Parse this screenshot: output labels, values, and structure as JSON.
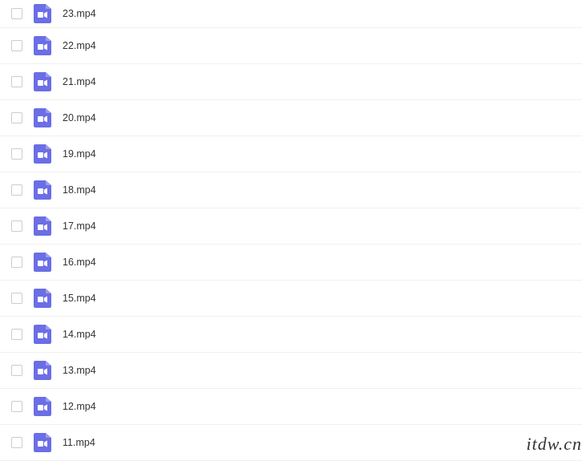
{
  "files": [
    {
      "name": "23.mp4"
    },
    {
      "name": "22.mp4"
    },
    {
      "name": "21.mp4"
    },
    {
      "name": "20.mp4"
    },
    {
      "name": "19.mp4"
    },
    {
      "name": "18.mp4"
    },
    {
      "name": "17.mp4"
    },
    {
      "name": "16.mp4"
    },
    {
      "name": "15.mp4"
    },
    {
      "name": "14.mp4"
    },
    {
      "name": "13.mp4"
    },
    {
      "name": "12.mp4"
    },
    {
      "name": "11.mp4"
    }
  ],
  "watermark": "itdw.cn",
  "icon_color": "#6b6ee5"
}
